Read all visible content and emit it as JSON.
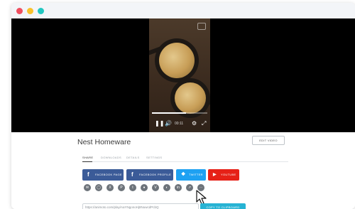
{
  "window": {
    "controls": [
      "close",
      "minimize",
      "maximize"
    ]
  },
  "player": {
    "progress_fraction": 0.62,
    "time": "00:11",
    "icons": [
      "pause-icon",
      "volume-icon",
      "settings-icon",
      "fullscreen-icon"
    ]
  },
  "video": {
    "title": "Nest Homeware",
    "edit_label": "EDIT VIDEO"
  },
  "tabs": [
    {
      "label": "SHARE",
      "active": true
    },
    {
      "label": "DOWNLOADS",
      "active": false
    },
    {
      "label": "DETAILS",
      "active": false
    },
    {
      "label": "SETTINGS",
      "active": false
    }
  ],
  "share_buttons": [
    {
      "label": "FACEBOOK PAGE",
      "icon": "f",
      "color": "#3b5b98"
    },
    {
      "label": "FACEBOOK PROFILE",
      "icon": "f",
      "color": "#3b5b98"
    },
    {
      "label": "TWITTER",
      "icon": "twitter-bird",
      "color": "#1ea1f2"
    },
    {
      "label": "YOUTUBE",
      "icon": "youtube-play",
      "color": "#e62117"
    }
  ],
  "social_icons": [
    "email-icon",
    "instagram-icon",
    "x-icon",
    "pinterest-icon",
    "tumblr-icon",
    "reddit-icon",
    "vimeo-icon",
    "other-icon",
    "linkedin-icon",
    "share-icon",
    "more-icon"
  ],
  "share_link": {
    "url": "https://animoto.com/play/AaYNgonoHj8NuwcdPcbQ",
    "copy_label": "COPY TO CLIPBOARD"
  }
}
